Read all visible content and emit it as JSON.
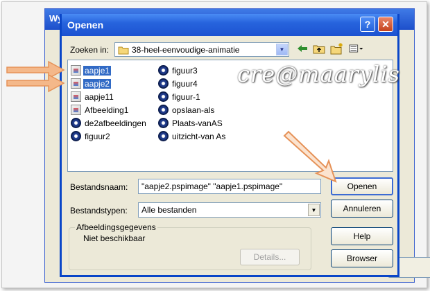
{
  "background_window": {
    "title_fragment": "Wy"
  },
  "dialog": {
    "title": "Openen",
    "help_glyph": "?",
    "close_glyph": "✕"
  },
  "lookin": {
    "label": "Zoeken in:",
    "value": "38-heel-eenvoudige-animatie"
  },
  "toolbar": {
    "icons": [
      "back-arrow-icon",
      "up-folder-icon",
      "new-folder-icon",
      "view-menu-icon"
    ]
  },
  "files": {
    "column1": [
      {
        "name": "aapje1",
        "icon": "image-file-icon",
        "selected": true
      },
      {
        "name": "aapje2",
        "icon": "image-file-icon",
        "selected": true
      },
      {
        "name": "aapje11",
        "icon": "image-file-icon",
        "selected": false
      },
      {
        "name": "Afbeelding1",
        "icon": "image-file-icon",
        "selected": false
      },
      {
        "name": "de2afbeeldingen",
        "icon": "animation-file-icon",
        "selected": false
      },
      {
        "name": "figuur2",
        "icon": "animation-file-icon",
        "selected": false
      }
    ],
    "column2": [
      {
        "name": "figuur3",
        "icon": "animation-file-icon",
        "selected": false
      },
      {
        "name": "figuur4",
        "icon": "animation-file-icon",
        "selected": false
      },
      {
        "name": "figuur-1",
        "icon": "animation-file-icon",
        "selected": false
      },
      {
        "name": "opslaan-als",
        "icon": "animation-file-icon",
        "selected": false
      },
      {
        "name": "Plaats-vanAS",
        "icon": "animation-file-icon",
        "selected": false
      },
      {
        "name": "uitzicht-van As",
        "icon": "animation-file-icon",
        "selected": false
      }
    ]
  },
  "filename": {
    "label": "Bestandsnaam:",
    "value": "\"aapje2.pspimage\" \"aapje1.pspimage\""
  },
  "filetype": {
    "label": "Bestandstypen:",
    "value": "Alle bestanden"
  },
  "buttons": {
    "open": "Openen",
    "cancel": "Annuleren",
    "help": "Help",
    "browser": "Browser"
  },
  "imageinfo": {
    "title": "Afbeeldingsgegevens",
    "status": "Niet beschikbaar",
    "details": "Details..."
  },
  "watermark": "cre@maarylis",
  "colors": {
    "titlebar": "#2764dd",
    "selection": "#316ac5",
    "annotation_arrow": "#f0a060"
  }
}
